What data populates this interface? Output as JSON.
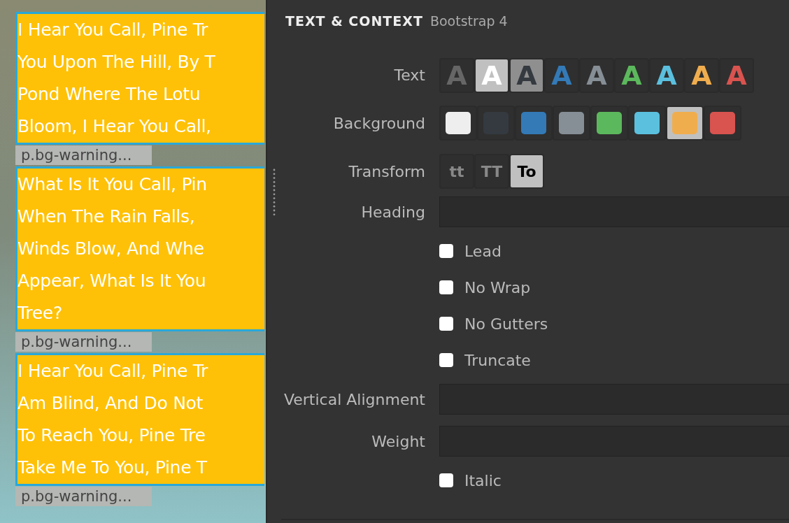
{
  "preview": {
    "paragraphs": [
      {
        "lines": [
          "I Hear You Call, Pine Tr",
          "You Upon The Hill, By T",
          "Pond Where The Lotu",
          "Bloom, I Hear You Call,"
        ],
        "tag": "p.bg-warning..."
      },
      {
        "lines": [
          "What Is It You Call, Pin",
          "When The Rain Falls,",
          "Winds Blow, And Whe",
          "Appear, What Is It You",
          "Tree?"
        ],
        "tag": "p.bg-warning..."
      },
      {
        "lines": [
          "I Hear You Call, Pine Tr",
          "Am Blind, And Do Not",
          "To Reach You, Pine Tre",
          "Take Me To You, Pine T"
        ],
        "tag": "p.bg-warning..."
      }
    ]
  },
  "panel": {
    "title": "TEXT & CONTEXT",
    "subtitle": "Bootstrap 4",
    "rows": [
      {
        "kind": "text-colors",
        "label": "Text",
        "options": [
          {
            "letter": "A",
            "color": "#666666",
            "selected": false
          },
          {
            "letter": "A",
            "color": "#ffffff",
            "selected": true
          },
          {
            "letter": "A",
            "color": "#343a40",
            "selected": false
          },
          {
            "letter": "A",
            "color": "#337ab7",
            "selected": false
          },
          {
            "letter": "A",
            "color": "#868e96",
            "selected": false
          },
          {
            "letter": "A",
            "color": "#5cb85c",
            "selected": false
          },
          {
            "letter": "A",
            "color": "#5bc0de",
            "selected": false
          },
          {
            "letter": "A",
            "color": "#f0ad4e",
            "selected": false
          },
          {
            "letter": "A",
            "color": "#d9534f",
            "selected": false
          }
        ]
      },
      {
        "kind": "bg-colors",
        "label": "Background",
        "options": [
          {
            "color": "#eeeeee",
            "selected": false
          },
          {
            "color": "#343a40",
            "selected": false
          },
          {
            "color": "#337ab7",
            "selected": false
          },
          {
            "color": "#868e96",
            "selected": false
          },
          {
            "color": "#5cb85c",
            "selected": false
          },
          {
            "color": "#5bc0de",
            "selected": false
          },
          {
            "color": "#f0ad4e",
            "selected": true
          },
          {
            "color": "#d9534f",
            "selected": false
          }
        ]
      },
      {
        "kind": "transform",
        "label": "Transform",
        "options": [
          {
            "label": "tt",
            "selected": false
          },
          {
            "label": "TT",
            "selected": false
          },
          {
            "label": "To",
            "selected": true
          }
        ]
      },
      {
        "kind": "select",
        "label": "Heading"
      },
      {
        "kind": "checkbox",
        "label": "Lead",
        "checked": false
      },
      {
        "kind": "checkbox",
        "label": "No Wrap",
        "checked": false
      },
      {
        "kind": "checkbox",
        "label": "No Gutters",
        "checked": false
      },
      {
        "kind": "checkbox",
        "label": "Truncate",
        "checked": false
      },
      {
        "kind": "select",
        "label": "Vertical Alignment"
      },
      {
        "kind": "select",
        "label": "Weight"
      },
      {
        "kind": "checkbox",
        "label": "Italic",
        "checked": false
      }
    ]
  }
}
